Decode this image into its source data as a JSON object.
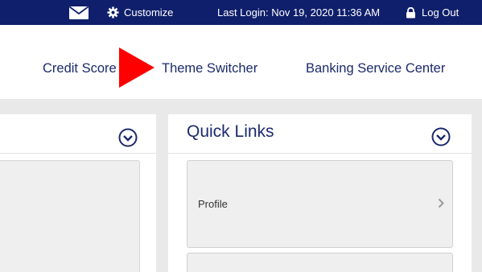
{
  "topbar": {
    "mail_icon": "envelope-icon",
    "customize_label": "Customize",
    "customize_icon": "gear-icon",
    "last_login": "Last Login: Nov 19, 2020 11:36 AM",
    "logout_label": "Log Out",
    "logout_icon": "lock-icon"
  },
  "nav": {
    "items": [
      {
        "label": "Credit Score"
      },
      {
        "label": "Theme Switcher"
      },
      {
        "label": "Banking Service Center"
      }
    ],
    "pointer_icon": "red-arrow-icon"
  },
  "panels": {
    "left": {
      "collapse_icon": "chevron-down-circle-icon"
    },
    "right": {
      "title": "Quick Links",
      "collapse_icon": "chevron-down-circle-icon",
      "links": [
        {
          "label": "Profile"
        },
        {
          "label": ""
        }
      ]
    }
  },
  "colors": {
    "topbar_bg": "#0f1f6b",
    "nav_text": "#1b2a6b",
    "arrow": "#ff0000",
    "content_bg": "#e9e9e9"
  }
}
